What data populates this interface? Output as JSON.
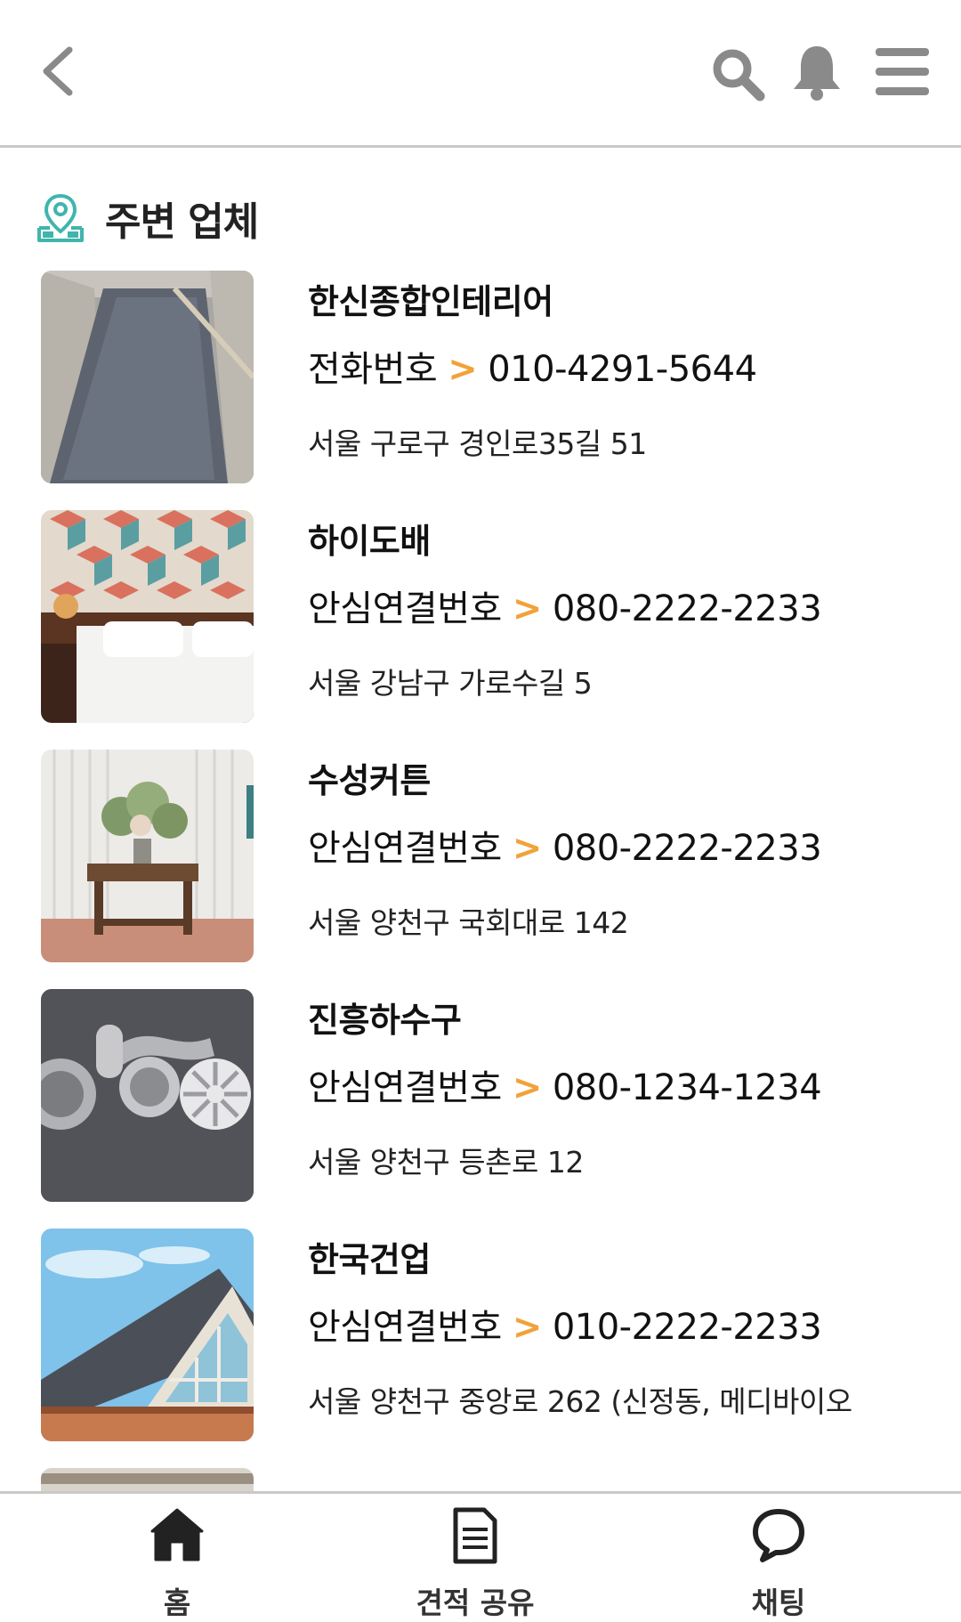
{
  "header": {
    "back_icon": "chevron-left-icon",
    "search_icon": "search-icon",
    "bell_icon": "bell-icon",
    "menu_icon": "hamburger-menu-icon"
  },
  "section": {
    "icon": "map-pin-icon",
    "title": "주변 업체"
  },
  "accent_color": "#f2a23a",
  "vendors": [
    {
      "name": "한신종합인테리어",
      "phone_label": "전화번호",
      "phone": "010-4291-5644",
      "address": "서울 구로구 경인로35길 51",
      "thumb": "gray-floor-coating"
    },
    {
      "name": "하이도배",
      "phone_label": "안심연결번호",
      "phone": "080-2222-2233",
      "address": "서울 강남구 가로수길 5",
      "thumb": "wallpaper-bedroom"
    },
    {
      "name": "수성커튼",
      "phone_label": "안심연결번호",
      "phone": "080-2222-2233",
      "address": "서울 양천구 국회대로 142",
      "thumb": "curtain-table-flowers"
    },
    {
      "name": "진흥하수구",
      "phone_label": "안심연결번호",
      "phone": "080-1234-1234",
      "address": "서울 양천구 등촌로 12",
      "thumb": "drain-parts"
    },
    {
      "name": "한국건업",
      "phone_label": "안심연결번호",
      "phone": "010-2222-2233",
      "address": "서울 양천구 중앙로 262 (신정동, 메디바이오",
      "thumb": "roof-house"
    }
  ],
  "nav": [
    {
      "label": "홈",
      "icon": "home-icon"
    },
    {
      "label": "견적 공유",
      "icon": "document-icon"
    },
    {
      "label": "채팅",
      "icon": "chat-bubble-icon"
    }
  ]
}
